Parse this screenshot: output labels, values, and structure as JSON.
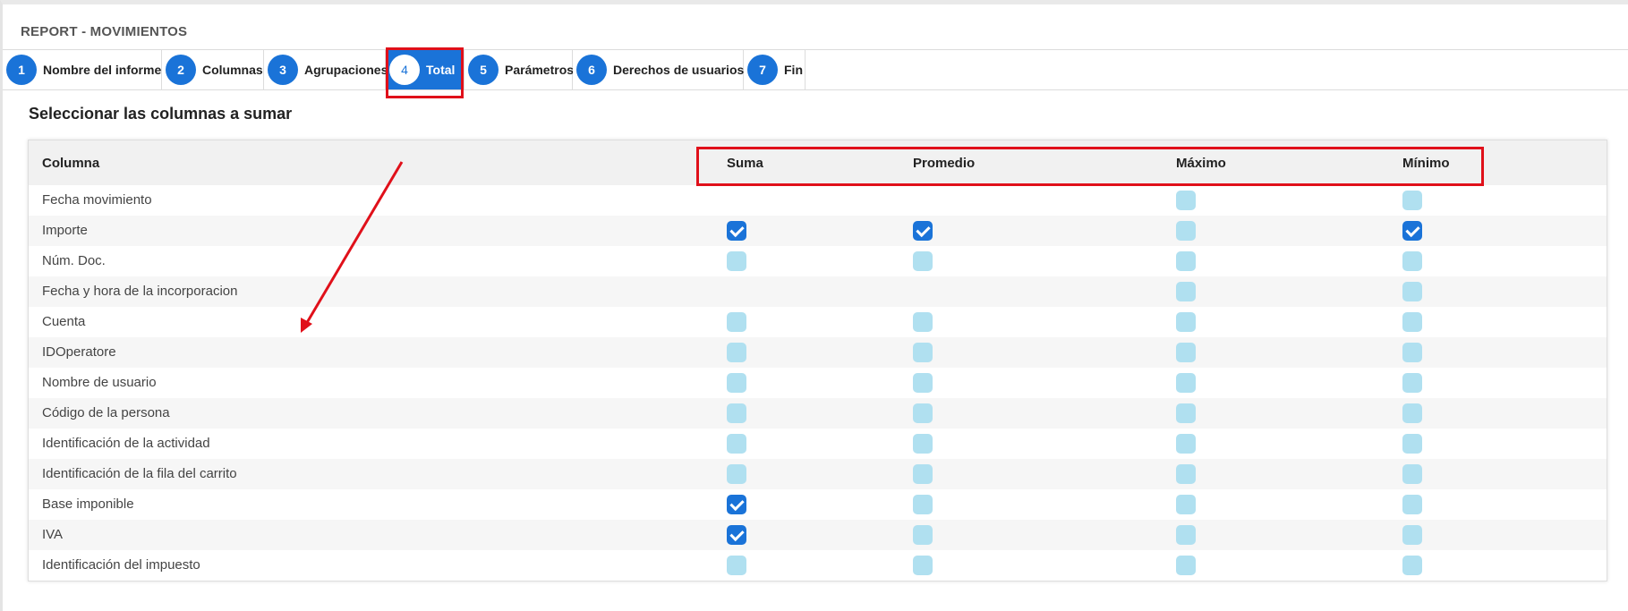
{
  "report": {
    "title": "REPORT - MOVIMIENTOS"
  },
  "tabs": [
    {
      "num": "1",
      "label": "Nombre del informe"
    },
    {
      "num": "2",
      "label": "Columnas"
    },
    {
      "num": "3",
      "label": "Agrupaciones"
    },
    {
      "num": "4",
      "label": "Total"
    },
    {
      "num": "5",
      "label": "Parámetros"
    },
    {
      "num": "6",
      "label": "Derechos de usuarios"
    },
    {
      "num": "7",
      "label": "Fin"
    }
  ],
  "active_tab": "Total",
  "section": {
    "title": "Seleccionar las columnas a sumar"
  },
  "table": {
    "headers": {
      "column": "Columna",
      "sum": "Suma",
      "avg": "Promedio",
      "max": "Máximo",
      "min": "Mínimo"
    },
    "rows": [
      {
        "name": "Fecha movimiento",
        "sum": null,
        "avg": null,
        "max": false,
        "min": false
      },
      {
        "name": "Importe",
        "sum": true,
        "avg": true,
        "max": false,
        "min": true
      },
      {
        "name": "Núm. Doc.",
        "sum": false,
        "avg": false,
        "max": false,
        "min": false
      },
      {
        "name": "Fecha y hora de la incorporacion",
        "sum": null,
        "avg": null,
        "max": false,
        "min": false
      },
      {
        "name": "Cuenta",
        "sum": false,
        "avg": false,
        "max": false,
        "min": false
      },
      {
        "name": "IDOperatore",
        "sum": false,
        "avg": false,
        "max": false,
        "min": false
      },
      {
        "name": "Nombre de usuario",
        "sum": false,
        "avg": false,
        "max": false,
        "min": false
      },
      {
        "name": "Código de la persona",
        "sum": false,
        "avg": false,
        "max": false,
        "min": false
      },
      {
        "name": "Identificación de la actividad",
        "sum": false,
        "avg": false,
        "max": false,
        "min": false
      },
      {
        "name": "Identificación de la fila del carrito",
        "sum": false,
        "avg": false,
        "max": false,
        "min": false
      },
      {
        "name": "Base imponible",
        "sum": true,
        "avg": false,
        "max": false,
        "min": false
      },
      {
        "name": "IVA",
        "sum": true,
        "avg": false,
        "max": false,
        "min": false
      },
      {
        "name": "Identificación del impuesto",
        "sum": false,
        "avg": false,
        "max": false,
        "min": false
      }
    ]
  },
  "colors": {
    "accent": "#1a73d8",
    "checkbox_off": "#b0e0f0",
    "annotation": "#e0101a"
  }
}
